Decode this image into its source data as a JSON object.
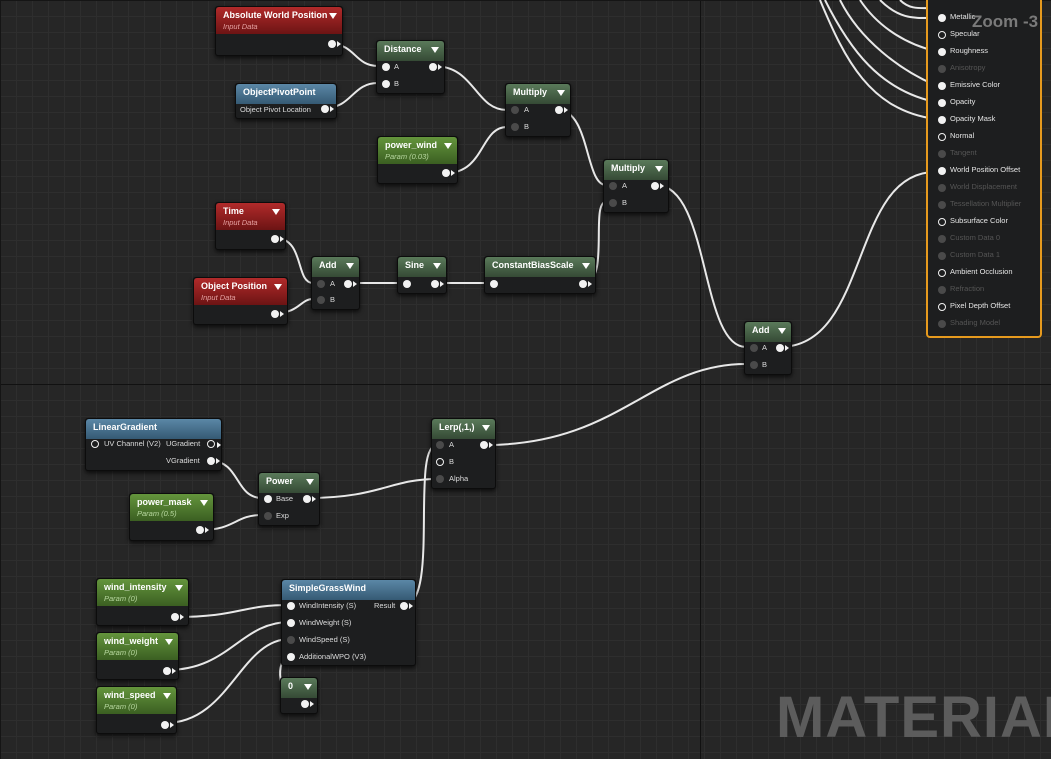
{
  "editor": {
    "zoom_label": "Zoom -3",
    "watermark": "MATERIAL"
  },
  "nodes": {
    "absolute_world_position": {
      "title": "Absolute World Position",
      "subtitle": "Input Data"
    },
    "distance": {
      "title": "Distance",
      "pins": [
        "A",
        "B"
      ]
    },
    "object_pivot_point": {
      "title": "ObjectPivotPoint",
      "output": "Object Pivot Location"
    },
    "multiply_1": {
      "title": "Multiply",
      "pins": [
        "A",
        "B"
      ]
    },
    "power_wind": {
      "title": "power_wind",
      "subtitle": "Param (0.03)"
    },
    "multiply_2": {
      "title": "Multiply",
      "pins": [
        "A",
        "B"
      ]
    },
    "time": {
      "title": "Time",
      "subtitle": "Input Data"
    },
    "object_position": {
      "title": "Object Position",
      "subtitle": "Input Data"
    },
    "add_1": {
      "title": "Add",
      "pins": [
        "A",
        "B"
      ]
    },
    "sine": {
      "title": "Sine"
    },
    "constant_bias_scale": {
      "title": "ConstantBiasScale"
    },
    "add_2": {
      "title": "Add",
      "pins": [
        "A",
        "B"
      ]
    },
    "linear_gradient": {
      "title": "LinearGradient",
      "input": "UV Channel (V2)",
      "outputs": [
        "UGradient",
        "VGradient"
      ]
    },
    "power": {
      "title": "Power",
      "pins": [
        "Base",
        "Exp"
      ]
    },
    "power_mask": {
      "title": "power_mask",
      "subtitle": "Param (0.5)"
    },
    "lerp": {
      "title": "Lerp(,1,)",
      "pins": [
        "A",
        "B",
        "Alpha"
      ]
    },
    "wind_intensity": {
      "title": "wind_intensity",
      "subtitle": "Param (0)"
    },
    "wind_weight": {
      "title": "wind_weight",
      "subtitle": "Param (0)"
    },
    "wind_speed": {
      "title": "wind_speed",
      "subtitle": "Param (0)"
    },
    "simple_grass_wind": {
      "title": "SimpleGrassWind",
      "inputs": [
        "WindIntensity (S)",
        "WindWeight (S)",
        "WindSpeed (S)",
        "AdditionalWPO (V3)"
      ],
      "output": "Result"
    },
    "constant_zero": {
      "title": "0"
    }
  },
  "result_node": {
    "pins": [
      {
        "label": "Metallic",
        "enabled": true,
        "connected": true
      },
      {
        "label": "Specular",
        "enabled": true,
        "connected": false
      },
      {
        "label": "Roughness",
        "enabled": true,
        "connected": true
      },
      {
        "label": "Anisotropy",
        "enabled": false,
        "connected": false
      },
      {
        "label": "Emissive Color",
        "enabled": true,
        "connected": true
      },
      {
        "label": "Opacity",
        "enabled": true,
        "connected": true
      },
      {
        "label": "Opacity Mask",
        "enabled": true,
        "connected": true
      },
      {
        "label": "Normal",
        "enabled": true,
        "connected": false
      },
      {
        "label": "Tangent",
        "enabled": false,
        "connected": false
      },
      {
        "label": "World Position Offset",
        "enabled": true,
        "connected": true
      },
      {
        "label": "World Displacement",
        "enabled": false,
        "connected": false
      },
      {
        "label": "Tessellation Multiplier",
        "enabled": false,
        "connected": false
      },
      {
        "label": "Subsurface Color",
        "enabled": true,
        "connected": false
      },
      {
        "label": "Custom Data 0",
        "enabled": false,
        "connected": false
      },
      {
        "label": "Custom Data 1",
        "enabled": false,
        "connected": false
      },
      {
        "label": "Ambient Occlusion",
        "enabled": true,
        "connected": false
      },
      {
        "label": "Refraction",
        "enabled": false,
        "connected": false
      },
      {
        "label": "Pixel Depth Offset",
        "enabled": true,
        "connected": false
      },
      {
        "label": "Shading Model",
        "enabled": false,
        "connected": false
      }
    ]
  },
  "colors": {
    "background": "#262626",
    "wire": "#e8e8e8",
    "result_border": "#e69a1e",
    "input_header": "#8c1d1d",
    "param_header": "#4f7a2e",
    "math_header": "#4a654a",
    "function_header": "#46708c"
  }
}
